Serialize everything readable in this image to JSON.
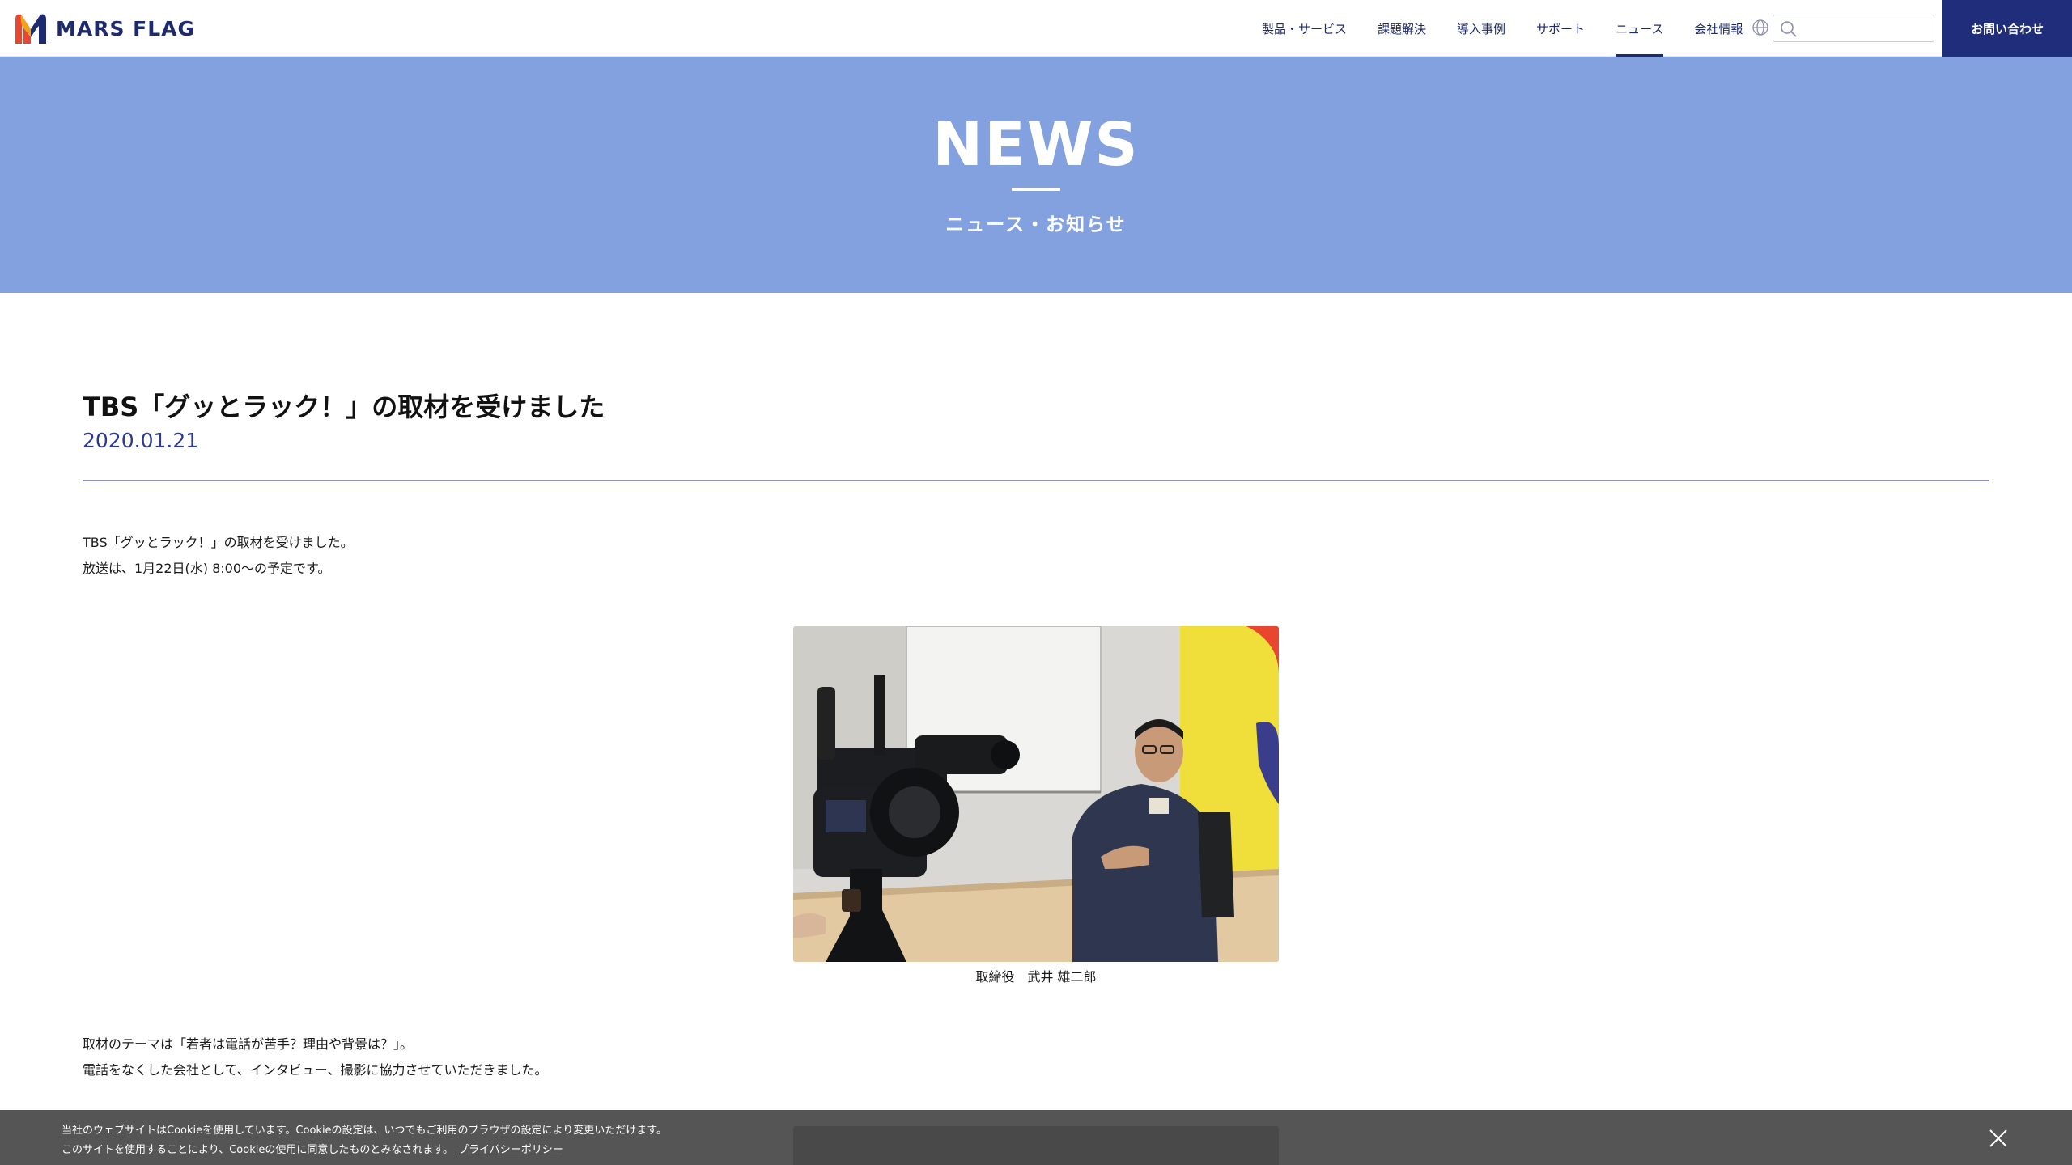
{
  "header": {
    "logo_text": "MARS FLAG",
    "nav": [
      {
        "label": "製品・サービス",
        "active": false
      },
      {
        "label": "課題解決",
        "active": false
      },
      {
        "label": "導入事例",
        "active": false
      },
      {
        "label": "サポート",
        "active": false
      },
      {
        "label": "ニュース",
        "active": true
      },
      {
        "label": "会社情報",
        "active": false
      }
    ],
    "language_icon": "globe-icon",
    "search": {
      "value": "",
      "placeholder": "",
      "icon": "search-icon"
    },
    "contact_label": "お問い合わせ"
  },
  "hero": {
    "title": "NEWS",
    "subtitle": "ニュース・お知らせ"
  },
  "article": {
    "title": "TBS「グッとラック！」の取材を受けました",
    "date": "2020.01.21",
    "intro_lines": [
      "TBS「グッとラック！」の取材を受けました。",
      "放送は、1月22日(水) 8:00～の予定です。"
    ],
    "photo_caption": "取締役　武井 雄二郎",
    "body_lines": [
      "取材のテーマは「若者は電話が苦手？理由や背景は？」。",
      "電話をなくした会社として、インタビュー、撮影に協力させていただきました。"
    ]
  },
  "cookie_banner": {
    "line1": "当社のウェブサイトはCookieを使用しています。Cookieの設定は、いつでもご利用のブラウザの設定により変更いただけます。",
    "line2": "このサイトを使用することにより、Cookieの使用に同意したものとみなされます。",
    "policy_link": "プライバシーポリシー",
    "close_icon": "close-icon"
  },
  "colors": {
    "brand_navy": "#1f2d7a",
    "hero_blue": "#83a1df",
    "date_blue": "#2c3a92",
    "logo_red": "#e8462f",
    "logo_orange": "#f3a21d",
    "logo_navy": "#1e2a6e"
  }
}
